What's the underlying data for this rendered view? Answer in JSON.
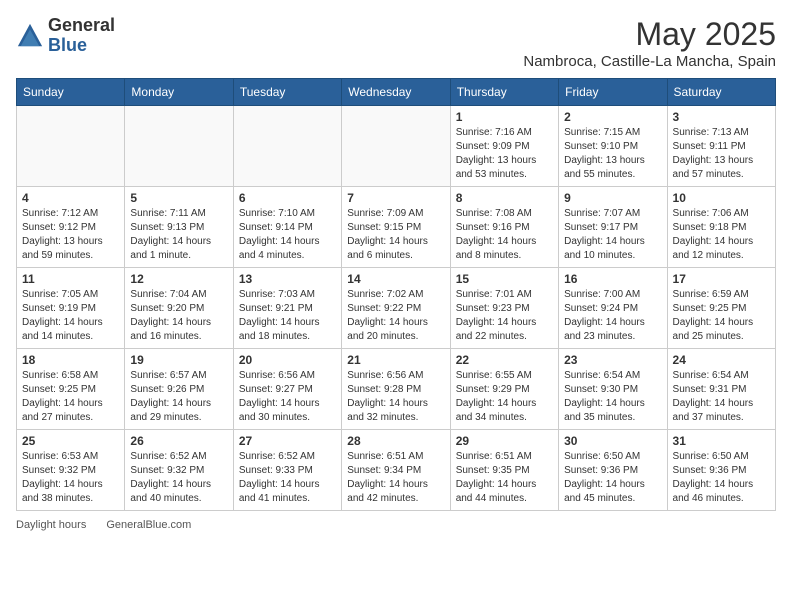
{
  "logo": {
    "general": "General",
    "blue": "Blue"
  },
  "title": "May 2025",
  "subtitle": "Nambroca, Castille-La Mancha, Spain",
  "days_of_week": [
    "Sunday",
    "Monday",
    "Tuesday",
    "Wednesday",
    "Thursday",
    "Friday",
    "Saturday"
  ],
  "weeks": [
    [
      {
        "day": "",
        "info": ""
      },
      {
        "day": "",
        "info": ""
      },
      {
        "day": "",
        "info": ""
      },
      {
        "day": "",
        "info": ""
      },
      {
        "day": "1",
        "info": "Sunrise: 7:16 AM\nSunset: 9:09 PM\nDaylight: 13 hours\nand 53 minutes."
      },
      {
        "day": "2",
        "info": "Sunrise: 7:15 AM\nSunset: 9:10 PM\nDaylight: 13 hours\nand 55 minutes."
      },
      {
        "day": "3",
        "info": "Sunrise: 7:13 AM\nSunset: 9:11 PM\nDaylight: 13 hours\nand 57 minutes."
      }
    ],
    [
      {
        "day": "4",
        "info": "Sunrise: 7:12 AM\nSunset: 9:12 PM\nDaylight: 13 hours\nand 59 minutes."
      },
      {
        "day": "5",
        "info": "Sunrise: 7:11 AM\nSunset: 9:13 PM\nDaylight: 14 hours\nand 1 minute."
      },
      {
        "day": "6",
        "info": "Sunrise: 7:10 AM\nSunset: 9:14 PM\nDaylight: 14 hours\nand 4 minutes."
      },
      {
        "day": "7",
        "info": "Sunrise: 7:09 AM\nSunset: 9:15 PM\nDaylight: 14 hours\nand 6 minutes."
      },
      {
        "day": "8",
        "info": "Sunrise: 7:08 AM\nSunset: 9:16 PM\nDaylight: 14 hours\nand 8 minutes."
      },
      {
        "day": "9",
        "info": "Sunrise: 7:07 AM\nSunset: 9:17 PM\nDaylight: 14 hours\nand 10 minutes."
      },
      {
        "day": "10",
        "info": "Sunrise: 7:06 AM\nSunset: 9:18 PM\nDaylight: 14 hours\nand 12 minutes."
      }
    ],
    [
      {
        "day": "11",
        "info": "Sunrise: 7:05 AM\nSunset: 9:19 PM\nDaylight: 14 hours\nand 14 minutes."
      },
      {
        "day": "12",
        "info": "Sunrise: 7:04 AM\nSunset: 9:20 PM\nDaylight: 14 hours\nand 16 minutes."
      },
      {
        "day": "13",
        "info": "Sunrise: 7:03 AM\nSunset: 9:21 PM\nDaylight: 14 hours\nand 18 minutes."
      },
      {
        "day": "14",
        "info": "Sunrise: 7:02 AM\nSunset: 9:22 PM\nDaylight: 14 hours\nand 20 minutes."
      },
      {
        "day": "15",
        "info": "Sunrise: 7:01 AM\nSunset: 9:23 PM\nDaylight: 14 hours\nand 22 minutes."
      },
      {
        "day": "16",
        "info": "Sunrise: 7:00 AM\nSunset: 9:24 PM\nDaylight: 14 hours\nand 23 minutes."
      },
      {
        "day": "17",
        "info": "Sunrise: 6:59 AM\nSunset: 9:25 PM\nDaylight: 14 hours\nand 25 minutes."
      }
    ],
    [
      {
        "day": "18",
        "info": "Sunrise: 6:58 AM\nSunset: 9:25 PM\nDaylight: 14 hours\nand 27 minutes."
      },
      {
        "day": "19",
        "info": "Sunrise: 6:57 AM\nSunset: 9:26 PM\nDaylight: 14 hours\nand 29 minutes."
      },
      {
        "day": "20",
        "info": "Sunrise: 6:56 AM\nSunset: 9:27 PM\nDaylight: 14 hours\nand 30 minutes."
      },
      {
        "day": "21",
        "info": "Sunrise: 6:56 AM\nSunset: 9:28 PM\nDaylight: 14 hours\nand 32 minutes."
      },
      {
        "day": "22",
        "info": "Sunrise: 6:55 AM\nSunset: 9:29 PM\nDaylight: 14 hours\nand 34 minutes."
      },
      {
        "day": "23",
        "info": "Sunrise: 6:54 AM\nSunset: 9:30 PM\nDaylight: 14 hours\nand 35 minutes."
      },
      {
        "day": "24",
        "info": "Sunrise: 6:54 AM\nSunset: 9:31 PM\nDaylight: 14 hours\nand 37 minutes."
      }
    ],
    [
      {
        "day": "25",
        "info": "Sunrise: 6:53 AM\nSunset: 9:32 PM\nDaylight: 14 hours\nand 38 minutes."
      },
      {
        "day": "26",
        "info": "Sunrise: 6:52 AM\nSunset: 9:32 PM\nDaylight: 14 hours\nand 40 minutes."
      },
      {
        "day": "27",
        "info": "Sunrise: 6:52 AM\nSunset: 9:33 PM\nDaylight: 14 hours\nand 41 minutes."
      },
      {
        "day": "28",
        "info": "Sunrise: 6:51 AM\nSunset: 9:34 PM\nDaylight: 14 hours\nand 42 minutes."
      },
      {
        "day": "29",
        "info": "Sunrise: 6:51 AM\nSunset: 9:35 PM\nDaylight: 14 hours\nand 44 minutes."
      },
      {
        "day": "30",
        "info": "Sunrise: 6:50 AM\nSunset: 9:36 PM\nDaylight: 14 hours\nand 45 minutes."
      },
      {
        "day": "31",
        "info": "Sunrise: 6:50 AM\nSunset: 9:36 PM\nDaylight: 14 hours\nand 46 minutes."
      }
    ]
  ],
  "footer": {
    "daylight_label": "Daylight hours",
    "site": "GeneralBlue.com"
  }
}
